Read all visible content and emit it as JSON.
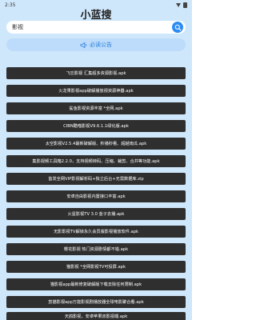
{
  "status_bar": {
    "time": "2:35"
  },
  "app": {
    "title": "小蓝搜"
  },
  "search": {
    "value": "影视",
    "button_icon": "search-icon"
  },
  "notice": {
    "icon": "megaphone-icon",
    "label": "必读公告"
  },
  "results": [
    "飞忘影视 汇集超多资源影视.apk",
    "火龙果影视app破解播放视资源神器.apk",
    "鲨鱼影视资源丰富 *全网.apk",
    "CIBN酷喵影视V9.6.1.1绿化版.apk",
    "太空影视V2.5.4最新破解版、秒播秒看、超越南瓜.apk",
    "集影视频工具箱2.2.0，支持视频转码、压缩、裁剪、合并等功能.apk",
    "首发全网VIP影视解析码+独立后台+无需数据库.zip",
    "安卓自由影视内置接口丰富.apk",
    "火星影视TV 3.0 金子去播.apk",
    "无影影视TV解锁永久会员版影视播放软件.apk",
    "樱花影视 热门资源剧情都不错.apk",
    "猫影视 *全网影视TV可投屏.apk",
    "猫影视app最新修复破解版下载去除任何限制.apk",
    "剪猫影视app万能影视剧播放器全球电影聚合看.apk",
    "天鸽影视，安卓苹果双影视端.apk"
  ]
}
